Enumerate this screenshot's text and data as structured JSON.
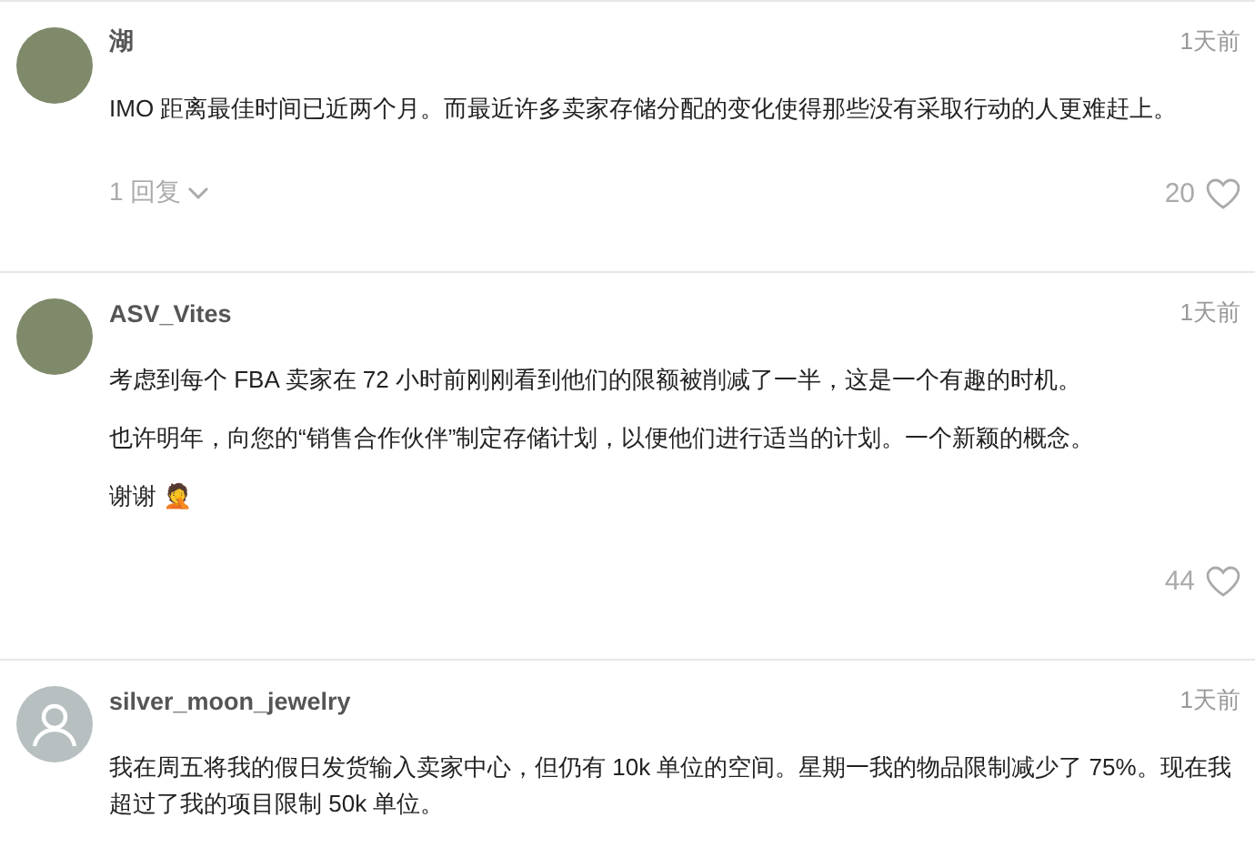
{
  "comments": [
    {
      "author": "湖",
      "kind": "photo",
      "time": "1天前",
      "paragraphs": [
        "IMO 距离最佳时间已近两个月。而最近许多卖家存储分配的变化使得那些没有采取行动的人更难赶上。"
      ],
      "replies": "1 回复",
      "likes": "20"
    },
    {
      "author": "ASV_Vites",
      "kind": "photo",
      "time": "1天前",
      "paragraphs": [
        "考虑到每个 FBA 卖家在 72 小时前刚刚看到他们的限额被削减了一半，这是一个有趣的时机。",
        "也许明年，向您的“销售合作伙伴”制定存储计划，以便他们进行适当的计划。一个新颖的概念。",
        "谢谢 🤦"
      ],
      "likes": "44"
    },
    {
      "author": "silver_moon_jewelry",
      "kind": "default",
      "time": "1天前",
      "paragraphs": [
        "我在周五将我的假日发货输入卖家中心，但仍有 10k 单位的空间。星期一我的物品限制减少了 75%。现在我超过了我的项目限制 50k 单位。"
      ]
    }
  ]
}
